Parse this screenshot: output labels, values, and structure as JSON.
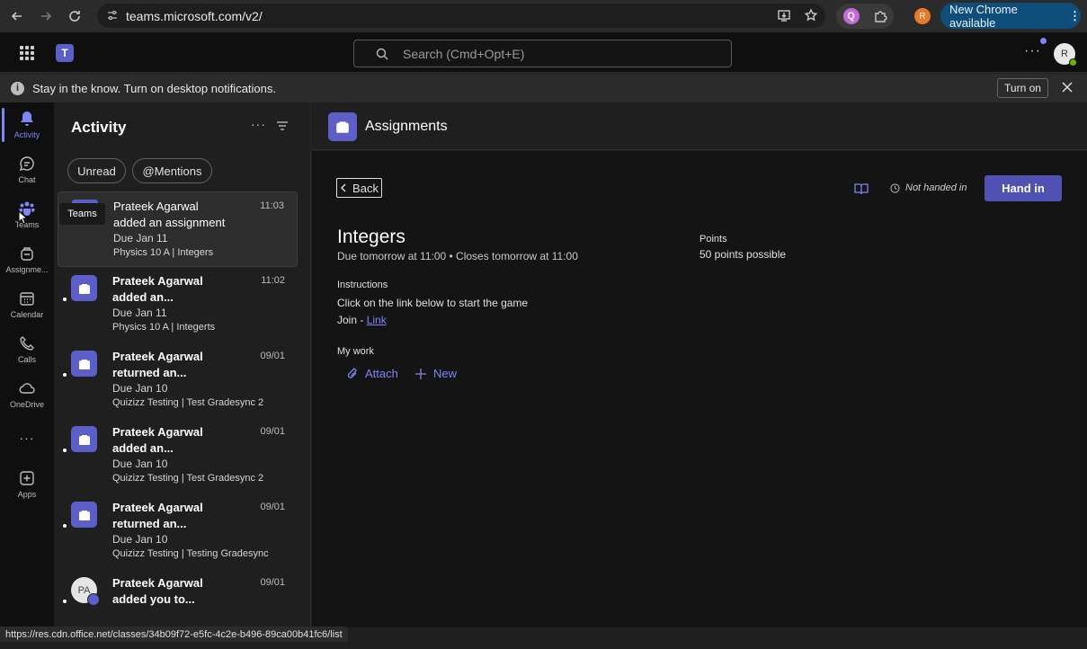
{
  "browser": {
    "url": "teams.microsoft.com/v2/",
    "extension_label": "Q",
    "profile_initial": "R",
    "update_label": "New Chrome available",
    "update_menu": "⋮"
  },
  "header": {
    "search_placeholder": "Search (Cmd+Opt+E)",
    "more": "···",
    "avatar_initial": "R"
  },
  "notification": {
    "info": "i",
    "text": "Stay in the know. Turn on desktop notifications.",
    "turn_on": "Turn on"
  },
  "rail": {
    "items": [
      {
        "label": "Activity"
      },
      {
        "label": "Chat"
      },
      {
        "label": "Teams"
      },
      {
        "label": "Assignme..."
      },
      {
        "label": "Calendar"
      },
      {
        "label": "Calls"
      },
      {
        "label": "OneDrive"
      },
      {
        "label": "···"
      },
      {
        "label": "Apps"
      }
    ],
    "tooltip": "Teams"
  },
  "activity": {
    "title": "Activity",
    "more": "···",
    "chips": [
      "Unread",
      "@Mentions"
    ],
    "items": [
      {
        "name": "Prateek Agarwal",
        "line2": "added an assignment",
        "due": "Due Jan 11",
        "context": "Physics 10 A | Integers",
        "time": "11:03"
      },
      {
        "name": "Prateek Agarwal",
        "line2": "added an...",
        "due": "Due Jan 11",
        "context": "Physics 10 A | Integerts",
        "time": "11:02"
      },
      {
        "name": "Prateek Agarwal",
        "line2": "returned an...",
        "due": "Due Jan 10",
        "context": "Quizizz Testing | Test Gradesync 2",
        "time": "09/01"
      },
      {
        "name": "Prateek Agarwal",
        "line2": "added an...",
        "due": "Due Jan 10",
        "context": "Quizizz Testing | Test Gradesync 2",
        "time": "09/01"
      },
      {
        "name": "Prateek Agarwal",
        "line2": "returned an...",
        "due": "Due Jan 10",
        "context": "Quizizz Testing | Testing Gradesync",
        "time": "09/01"
      },
      {
        "name": "Prateek Agarwal",
        "line2": "added you to...",
        "initials": "PA",
        "time": "09/01"
      }
    ]
  },
  "assignment": {
    "app_title": "Assignments",
    "back": "Back",
    "status": "Not handed in",
    "hand_in": "Hand in",
    "title": "Integers",
    "due": "Due tomorrow at 11:00 • Closes tomorrow at 11:00",
    "points_label": "Points",
    "points_value": "50 points possible",
    "instructions_label": "Instructions",
    "instructions_text": "Click on the link below to start the game",
    "join_prefix": "Join - ",
    "join_link": "Link",
    "my_work_label": "My work",
    "attach": "Attach",
    "new": "New"
  },
  "status_url": "https://res.cdn.office.net/classes/34b09f72-e5fc-4c2e-b496-89ca00b41fc6/list",
  "colors": {
    "accent": "#7f85f5",
    "brand": "#5b5fc7",
    "hand_in": "#4f52b2"
  }
}
